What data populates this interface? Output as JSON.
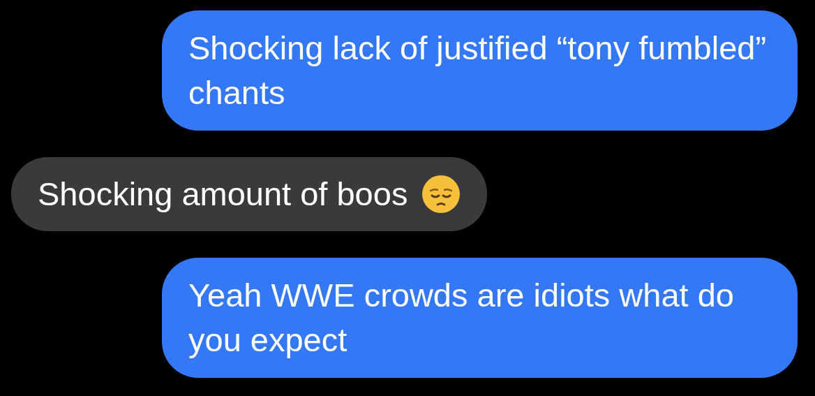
{
  "messages": [
    {
      "kind": "sent",
      "text": "Shocking lack of justified “tony fumbled” chants"
    },
    {
      "kind": "received",
      "text": "Shocking amount of boos",
      "emoji": true
    },
    {
      "kind": "sent",
      "text": "Yeah WWE crowds are idiots what do you expect"
    }
  ]
}
